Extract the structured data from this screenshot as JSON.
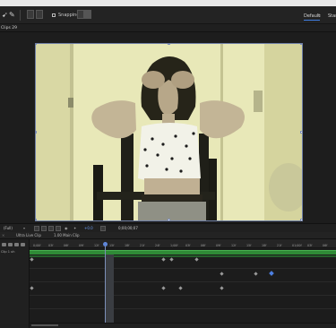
{
  "toolbar": {
    "snapping_label": "Snapping",
    "workspaces": [
      "Default",
      "Standa"
    ]
  },
  "panel_tab": "Clips 29",
  "viewer": {
    "zoom": "(Full)",
    "fps_value": "+0.0",
    "timecode": "0;00;00;07"
  },
  "timeline": {
    "tabs": [
      "Ultra Live Clip",
      "1.00 Main Clip"
    ],
    "layer_label": "Clip 1 uh",
    "ruler_ticks": [
      "0;00f",
      "03f",
      "06f",
      "09f",
      "12f",
      "15f",
      "18f",
      "21f",
      "24f",
      "1;00f",
      "03f",
      "06f",
      "09f",
      "12f",
      "15f",
      "18f",
      "21f",
      "01;00f",
      "03f",
      "06f"
    ]
  },
  "colors": {
    "accent": "#5f86d8",
    "clip_green": "#2f8a36",
    "selected_keyframe": "#4d7fe0"
  },
  "icons": [
    "select-icon",
    "pen-icon",
    "snap-icon",
    "play-icon",
    "loop-icon",
    "mute-icon"
  ]
}
